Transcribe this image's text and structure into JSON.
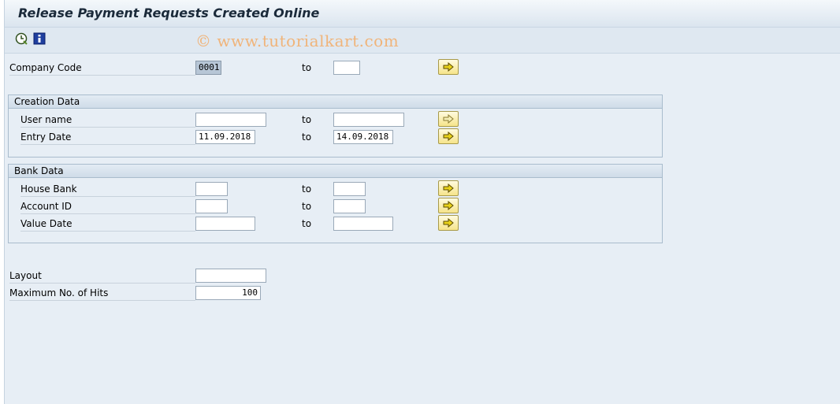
{
  "window": {
    "title": "Release Payment Requests Created Online"
  },
  "toolbar": {
    "watermark": "© www.tutorialkart.com"
  },
  "company_code": {
    "label": "Company Code",
    "from": "0001",
    "to_label": "to",
    "to": ""
  },
  "creation_data": {
    "title": "Creation Data",
    "user_name": {
      "label": "User name",
      "from": "",
      "to_label": "to",
      "to": ""
    },
    "entry_date": {
      "label": "Entry Date",
      "from": "11.09.2018",
      "to_label": "to",
      "to": "14.09.2018"
    }
  },
  "bank_data": {
    "title": "Bank Data",
    "house_bank": {
      "label": "House Bank",
      "from": "",
      "to_label": "to",
      "to": ""
    },
    "account_id": {
      "label": "Account ID",
      "from": "",
      "to_label": "to",
      "to": ""
    },
    "value_date": {
      "label": "Value Date",
      "from": "",
      "to_label": "to",
      "to": ""
    }
  },
  "layout": {
    "label": "Layout",
    "value": ""
  },
  "max_hits": {
    "label": "Maximum No. of Hits",
    "value": "100"
  },
  "colors": {
    "accent_arrow": "#f6e48a",
    "background": "#e7eef5"
  }
}
